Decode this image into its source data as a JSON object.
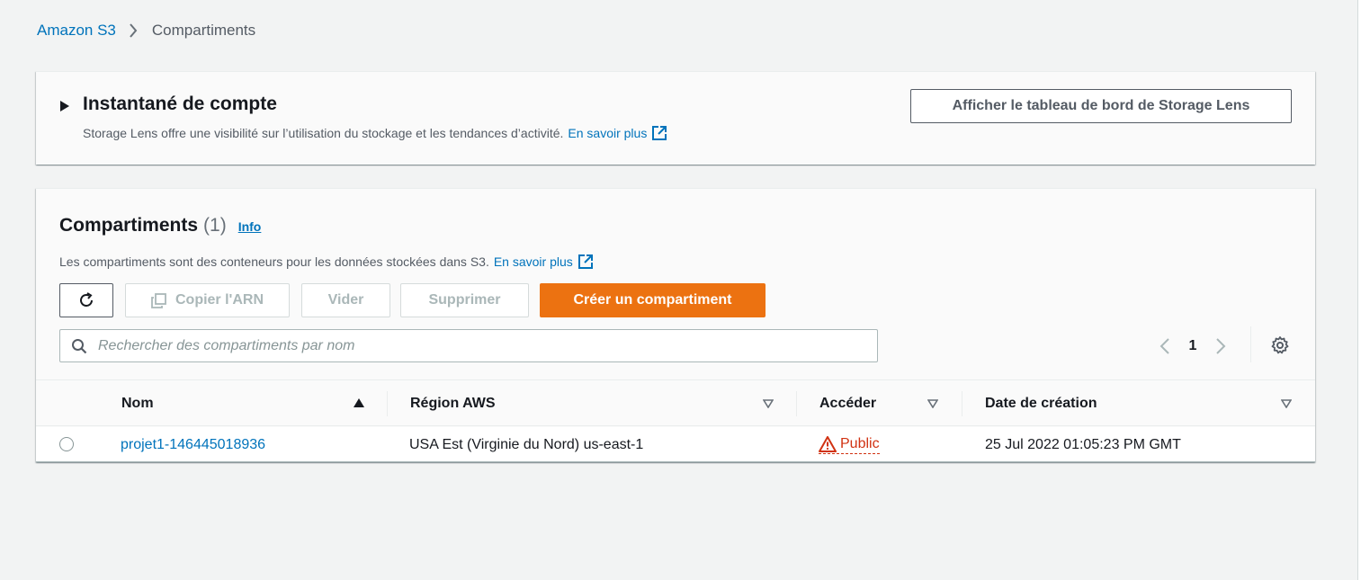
{
  "breadcrumb": {
    "root": "Amazon S3",
    "current": "Compartiments"
  },
  "snapshot": {
    "title": "Instantané de compte",
    "description": "Storage Lens offre une visibilité sur l’utilisation du stockage et les tendances d’activité.",
    "learn_more": "En savoir plus",
    "dashboard_button": "Afficher le tableau de bord de Storage Lens"
  },
  "buckets": {
    "title": "Compartiments",
    "count": "(1)",
    "info": "Info",
    "description": "Les compartiments sont des conteneurs pour les données stockées dans S3.",
    "learn_more": "En savoir plus",
    "toolbar": {
      "copy_arn": "Copier l'ARN",
      "empty": "Vider",
      "delete": "Supprimer",
      "create": "Créer un compartiment"
    },
    "search": {
      "placeholder": "Rechercher des compartiments par nom",
      "value": ""
    },
    "pagination": {
      "page": "1"
    },
    "columns": [
      "Nom",
      "Région AWS",
      "Accéder",
      "Date de création"
    ],
    "rows": [
      {
        "name": "projet1-146445018936",
        "region": "USA Est (Virginie du Nord) us-east-1",
        "access": "Public",
        "created": "25 Jul 2022 01:05:23 PM GMT"
      }
    ]
  },
  "colors": {
    "link": "#0073bb",
    "primary": "#ec7211",
    "warning": "#d13212",
    "background": "#f2f3f3"
  },
  "icons": [
    "chevron-right-icon",
    "caret-right-icon",
    "external-link-icon",
    "refresh-icon",
    "copy-icon",
    "search-icon",
    "chevron-left-icon",
    "gear-icon",
    "sort-ascending-icon",
    "sort-icon",
    "warning-icon"
  ]
}
